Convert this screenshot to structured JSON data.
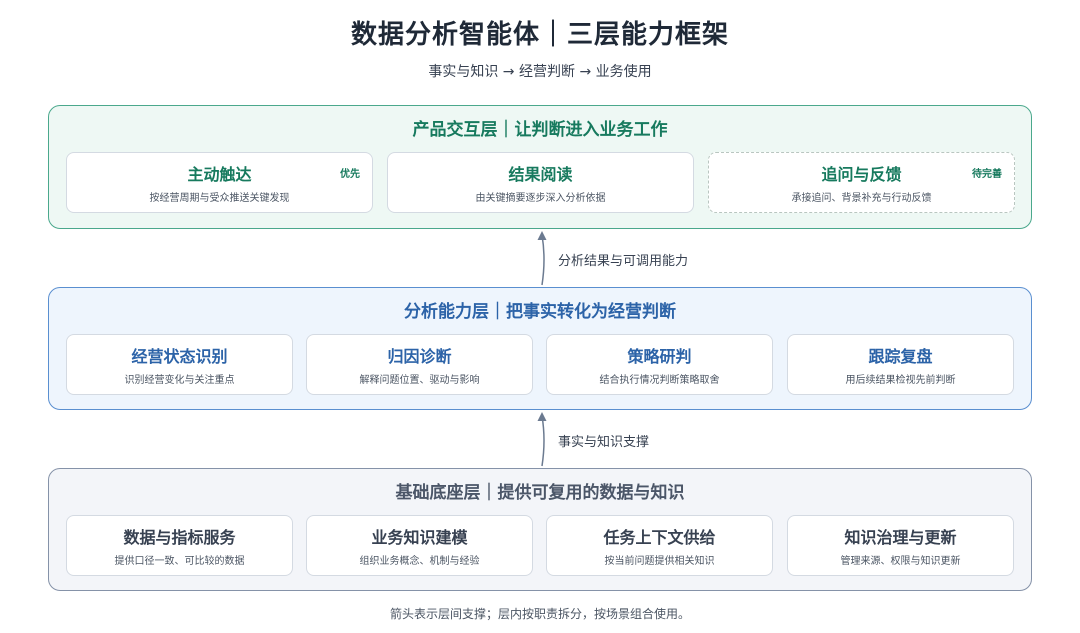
{
  "title": "数据分析智能体｜三层能力框架",
  "subtitle": "事实与知识 → 经营判断 → 业务使用",
  "layers": {
    "top": {
      "title": "产品交互层｜让判断进入业务工作",
      "cards": [
        {
          "title": "主动触达",
          "desc": "按经营周期与受众推送关键发现",
          "tag": "优先"
        },
        {
          "title": "结果阅读",
          "desc": "由关键摘要逐步深入分析依据"
        },
        {
          "title": "追问与反馈",
          "desc": "承接追问、背景补充与行动反馈",
          "tag": "待完善"
        }
      ]
    },
    "mid": {
      "title": "分析能力层｜把事实转化为经营判断",
      "cards": [
        {
          "title": "经营状态识别",
          "desc": "识别经营变化与关注重点"
        },
        {
          "title": "归因诊断",
          "desc": "解释问题位置、驱动与影响"
        },
        {
          "title": "策略研判",
          "desc": "结合执行情况判断策略取舍"
        },
        {
          "title": "跟踪复盘",
          "desc": "用后续结果检视先前判断"
        }
      ]
    },
    "bot": {
      "title": "基础底座层｜提供可复用的数据与知识",
      "cards": [
        {
          "title": "数据与指标服务",
          "desc": "提供口径一致、可比较的数据"
        },
        {
          "title": "业务知识建模",
          "desc": "组织业务概念、机制与经验"
        },
        {
          "title": "任务上下文供给",
          "desc": "按当前问题提供相关知识"
        },
        {
          "title": "知识治理与更新",
          "desc": "管理来源、权限与知识更新"
        }
      ]
    }
  },
  "arrows": {
    "upper_label": "分析结果与可调用能力",
    "lower_label": "事实与知识支撑"
  },
  "footnote": "箭头表示层间支撑；层内按职责拆分，按场景组合使用。",
  "colors": {
    "top_accent": "#177a5e",
    "mid_accent": "#2c63a8",
    "bot_accent": "#4b5668",
    "arrow": "#6b7a90"
  }
}
